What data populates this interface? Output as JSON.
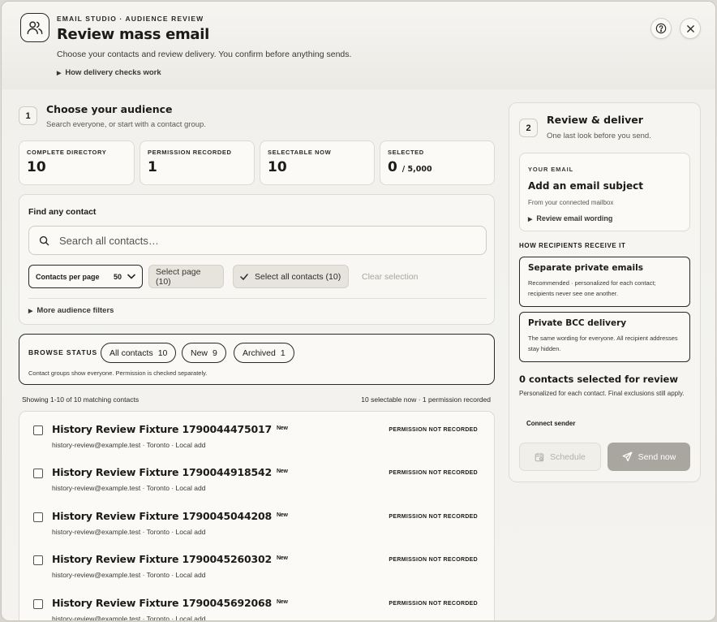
{
  "header": {
    "kicker": "EMAIL STUDIO · AUDIENCE REVIEW",
    "title": "Review mass email",
    "subtitle": "Choose your contacts and review delivery. You confirm before anything sends.",
    "disclosure": "How delivery checks work"
  },
  "audience": {
    "step": "1",
    "title": "Choose your audience",
    "subtitle": "Search everyone, or start with a contact group.",
    "stats": [
      {
        "label": "COMPLETE DIRECTORY",
        "value": "10",
        "suffix": ""
      },
      {
        "label": "PERMISSION RECORDED",
        "value": "1",
        "suffix": ""
      },
      {
        "label": "SELECTABLE NOW",
        "value": "10",
        "suffix": ""
      },
      {
        "label": "SELECTED",
        "value": "0",
        "suffix": "/ 5,000"
      }
    ],
    "find": {
      "title": "Find any contact",
      "placeholder": "Search all contacts…",
      "per_page_label": "Contacts per page",
      "per_page_value": "50",
      "select_page": "Select page (10)",
      "select_all": "Select all contacts (10)",
      "clear": "Clear selection",
      "more_filters": "More audience filters"
    },
    "browse": {
      "label": "BROWSE STATUS",
      "chips": [
        {
          "name": "All contacts",
          "count": "10"
        },
        {
          "name": "New",
          "count": "9"
        },
        {
          "name": "Archived",
          "count": "1"
        }
      ],
      "note": "Contact groups show everyone. Permission is checked separately."
    },
    "results": {
      "showing": "Showing 1-10 of 10 matching contacts",
      "summary": "10 selectable now · 1 permission recorded"
    },
    "contacts": [
      {
        "name": "History Review Fixture 1790044475017",
        "badge": "New",
        "meta": "history-review@example.test · Toronto · Local add",
        "permission": "PERMISSION NOT RECORDED"
      },
      {
        "name": "History Review Fixture 1790044918542",
        "badge": "New",
        "meta": "history-review@example.test · Toronto · Local add",
        "permission": "PERMISSION NOT RECORDED"
      },
      {
        "name": "History Review Fixture 1790045044208",
        "badge": "New",
        "meta": "history-review@example.test · Toronto · Local add",
        "permission": "PERMISSION NOT RECORDED"
      },
      {
        "name": "History Review Fixture 1790045260302",
        "badge": "New",
        "meta": "history-review@example.test · Toronto · Local add",
        "permission": "PERMISSION NOT RECORDED"
      },
      {
        "name": "History Review Fixture 1790045692068",
        "badge": "New",
        "meta": "history-review@example.test · Toronto · Local add",
        "permission": "PERMISSION NOT RECORDED"
      }
    ]
  },
  "deliver": {
    "step": "2",
    "title": "Review & deliver",
    "subtitle": "One last look before you send.",
    "email": {
      "label": "YOUR EMAIL",
      "subject": "Add an email subject",
      "from": "From your connected mailbox",
      "review": "Review email wording"
    },
    "how_label": "HOW RECIPIENTS RECEIVE IT",
    "options": [
      {
        "title": "Separate private emails",
        "desc": "Recommended · personalized for each contact; recipients never see one another."
      },
      {
        "title": "Private BCC delivery",
        "desc": "The same wording for everyone. All recipient addresses stay hidden."
      }
    ],
    "count_title": "0 contacts selected for review",
    "count_note": "Personalized for each contact. Final exclusions still apply.",
    "connect": "Connect sender",
    "schedule": "Schedule",
    "send": "Send now"
  }
}
